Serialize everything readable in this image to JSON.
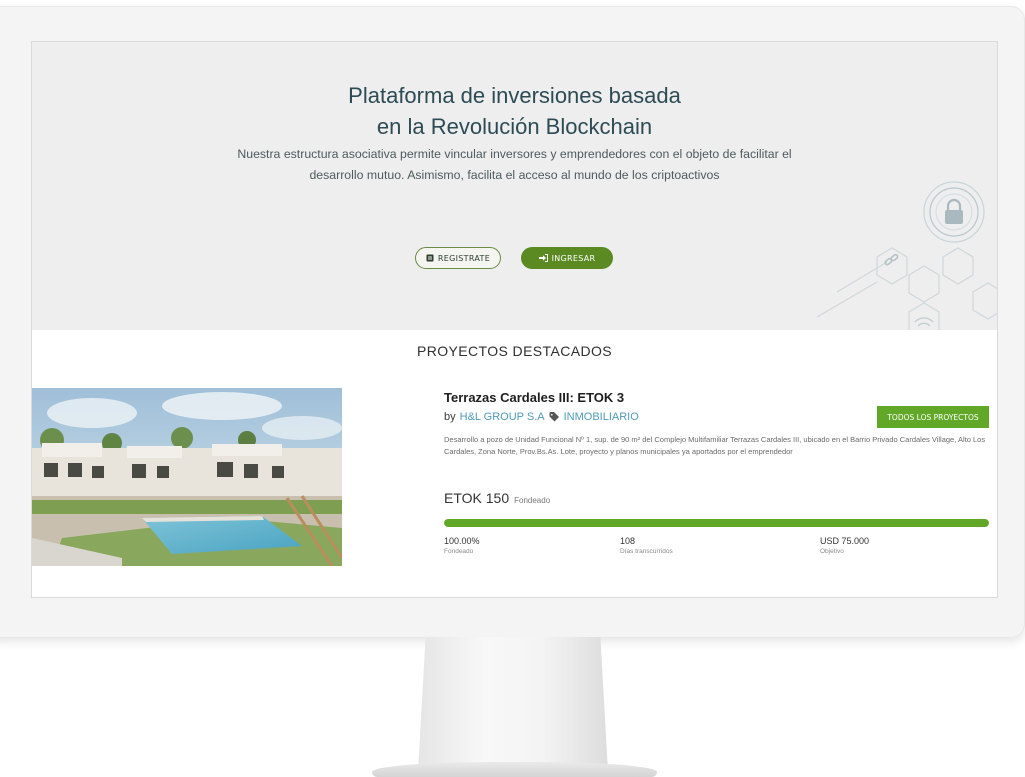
{
  "hero": {
    "title_line1": "Plataforma de inversiones basada",
    "title_line2": "en la Revolución Blockchain",
    "description": "Nuestra estructura asociativa permite vincular inversores y emprendedores con el objeto de facilitar el desarrollo mutuo. Asimismo, facilita el acceso al mundo de los criptoactivos",
    "register_label": "REGISTRATE",
    "login_label": "INGRESAR",
    "register_icon": "user-card-icon",
    "login_icon": "sign-in-icon"
  },
  "featured": {
    "section_title": "PROYECTOS DESTACADOS",
    "all_projects_label": "TODOS LOS PROYECTOS",
    "project": {
      "title": "Terrazas Cardales III: ETOK 3",
      "by_prefix": "by",
      "developer": "H&L GROUP S.A",
      "category": "INMOBILIARIO",
      "category_icon": "tag-icon",
      "description": "Desarrollo a pozo de Unidad Funcional Nº 1, sup. de 90 m² del Complejo Multifamiliar Terrazas Cardales III, ubicado en el Barrio Privado Cardales Village, Alto Los Cardales, Zona Norte, Prov.Bs.As. Lote, proyecto y planos municipales ya aportados por el emprendedor",
      "token_value": "ETOK 150",
      "token_label": "Fondeado",
      "progress_percent": 100,
      "stats": [
        {
          "value": "100.00%",
          "label": "Fondeado"
        },
        {
          "value": "108",
          "label": "Días transcurridos"
        },
        {
          "value": "USD 75.000",
          "label": "Objetivo"
        }
      ]
    }
  },
  "colors": {
    "accent_green": "#62a828",
    "title_teal": "#2d4b55",
    "link_blue": "#4e9bb7"
  }
}
